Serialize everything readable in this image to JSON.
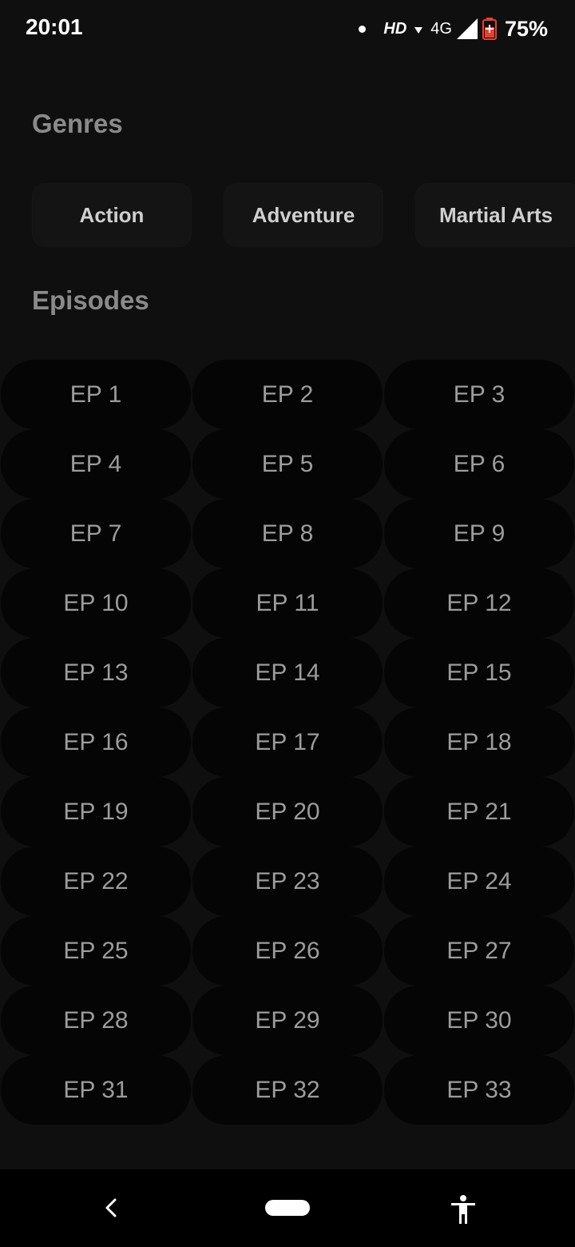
{
  "status_bar": {
    "time": "20:01",
    "hd_label": "HD",
    "network_label": "4G",
    "battery_percent": "75%"
  },
  "genres": {
    "title": "Genres",
    "items": [
      "Action",
      "Adventure",
      "Martial Arts"
    ]
  },
  "episodes": {
    "title": "Episodes",
    "items": [
      "EP 1",
      "EP 2",
      "EP 3",
      "EP 4",
      "EP 5",
      "EP 6",
      "EP 7",
      "EP 8",
      "EP 9",
      "EP 10",
      "EP 11",
      "EP 12",
      "EP 13",
      "EP 14",
      "EP 15",
      "EP 16",
      "EP 17",
      "EP 18",
      "EP 19",
      "EP 20",
      "EP 21",
      "EP 22",
      "EP 23",
      "EP 24",
      "EP 25",
      "EP 26",
      "EP 27",
      "EP 28",
      "EP 29",
      "EP 30",
      "EP 31",
      "EP 32",
      "EP 33"
    ]
  },
  "nav_bar": {
    "icons": [
      "back-icon",
      "home-pill-icon",
      "accessibility-icon"
    ]
  },
  "colors": {
    "background": "#0f0f0f",
    "episode_button": "#050505",
    "genre_chip": "#141414",
    "section_title": "#8a8a8a",
    "battery_accent": "#e8412c"
  }
}
